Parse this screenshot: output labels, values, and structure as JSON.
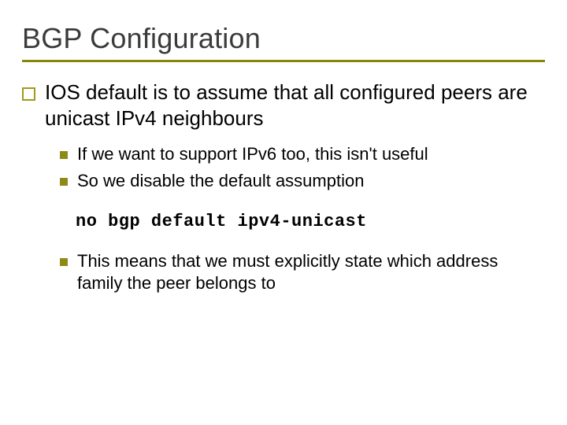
{
  "slide": {
    "title": "BGP Configuration",
    "main_point": "IOS default is to assume that all configured peers are unicast IPv4 neighbours",
    "sub_points_a": [
      "If we want to support IPv6 too, this isn't useful",
      "So we disable the default assumption"
    ],
    "code": "no bgp default ipv4-unicast",
    "sub_points_b": [
      "This means that we must explicitly state which address family the peer belongs to"
    ]
  }
}
